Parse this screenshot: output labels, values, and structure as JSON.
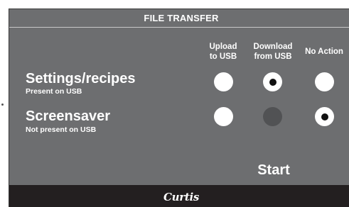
{
  "title": "FILE TRANSFER",
  "columns": [
    {
      "line1": "Upload",
      "line2": "to USB"
    },
    {
      "line1": "Download",
      "line2": "from USB"
    },
    {
      "line1": "No Action",
      "line2": ""
    }
  ],
  "rows": [
    {
      "title": "Settings/recipes",
      "subtitle": "Present on USB",
      "options": [
        "enabled",
        "selected",
        "enabled"
      ]
    },
    {
      "title": "Screensaver",
      "subtitle": "Not present on USB",
      "options": [
        "enabled",
        "disabled",
        "selected"
      ]
    }
  ],
  "start_label": "Start",
  "footer": {
    "logo_text": "Curtis"
  },
  "colors": {
    "panel": "#6d6e70",
    "footer": "#231f20",
    "radio": "#ffffff",
    "radio_disabled": "#515254",
    "radio_dot": "#111111"
  }
}
